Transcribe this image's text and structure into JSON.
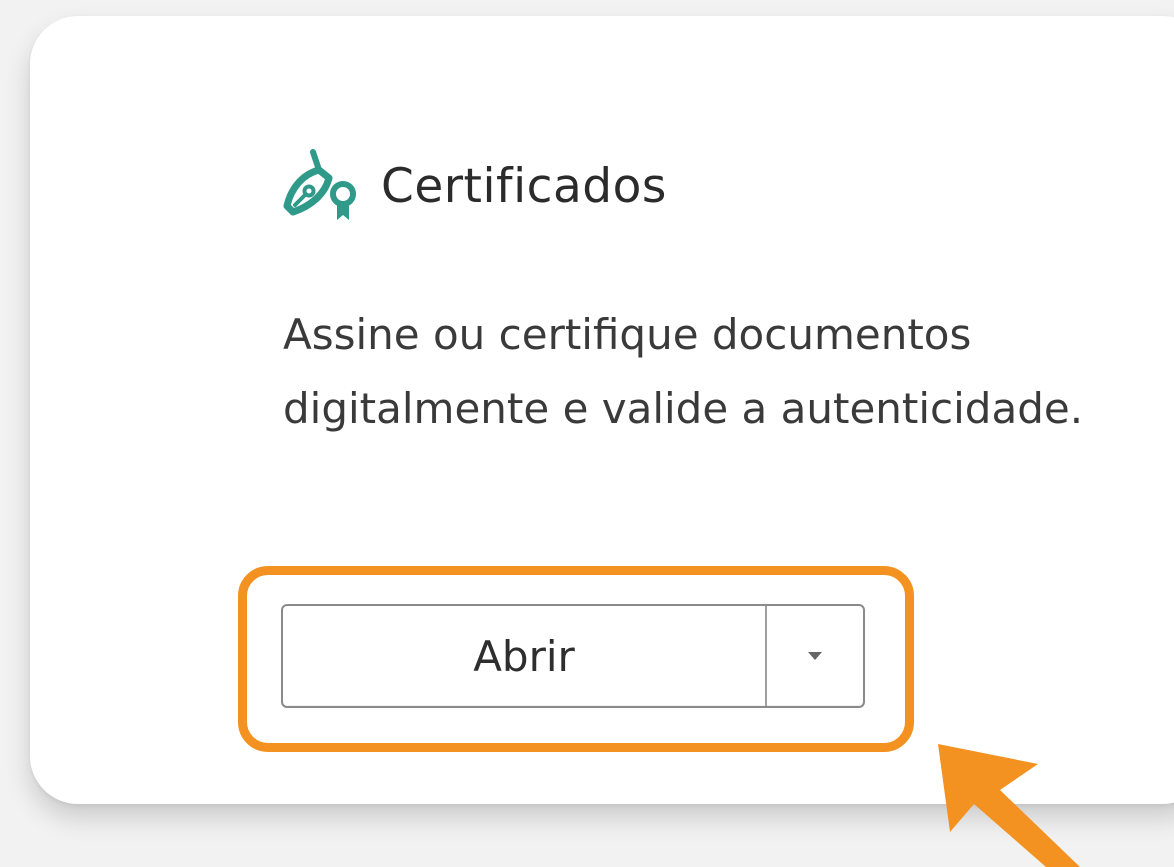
{
  "card": {
    "title": "Certificados",
    "description": "Assine ou certifique documentos digitalmente e valide a autenticidade.",
    "icon": "certificate-pen-icon"
  },
  "split_button": {
    "label": "Abrir",
    "dropdown_icon": "chevron-down-icon"
  },
  "colors": {
    "background": "#f2f2f2",
    "card": "#ffffff",
    "highlight": "#f39221",
    "icon_accent": "#2f9a89",
    "text": "#2b2b2b"
  }
}
